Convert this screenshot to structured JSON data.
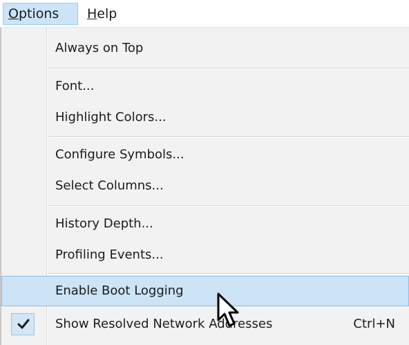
{
  "menubar": {
    "options": {
      "pre": "",
      "accel": "O",
      "post": "ptions"
    },
    "help": {
      "pre": "",
      "accel": "H",
      "post": "elp"
    }
  },
  "menu": {
    "items": [
      {
        "label": "Always on Top"
      },
      {
        "label": "Font..."
      },
      {
        "label": "Highlight Colors..."
      },
      {
        "label": "Configure Symbols..."
      },
      {
        "label": "Select Columns..."
      },
      {
        "label": "History Depth..."
      },
      {
        "label": "Profiling Events..."
      },
      {
        "label": "Enable Boot Logging"
      },
      {
        "label": "Show Resolved Network Addresses",
        "shortcut": "Ctrl+N",
        "checked": true
      }
    ]
  },
  "colors": {
    "highlight": "#cde3f6",
    "highlight_border": "#8fbde4",
    "menu_bg": "#f2f2f2"
  },
  "icons": {
    "check": "check-icon",
    "cursor": "mouse-pointer-icon"
  }
}
